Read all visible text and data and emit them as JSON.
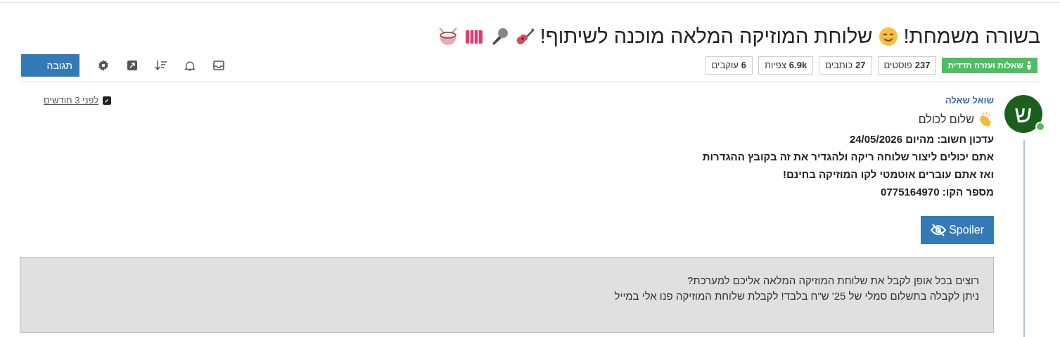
{
  "topic": {
    "title_start": "בשורה משמחת!",
    "title_end": "שלוחת המוזיקה המלאה מוכנה לשיתוף!",
    "category": "שאלות ועזרה הדדית",
    "stats": [
      {
        "value": "237",
        "label": "פוסטים"
      },
      {
        "value": "27",
        "label": "כותבים"
      },
      {
        "value": "6.9k",
        "label": "צפיות"
      },
      {
        "value": "6",
        "label": "עוקבים"
      }
    ]
  },
  "toolbar": {
    "reply_button": "תגובה"
  },
  "post": {
    "avatar_letter": "ש",
    "online": true,
    "author": "שואל שאלה",
    "time": "לפני 3 חודשים",
    "greeting": "שלום לכולם",
    "bold_lines": [
      "עדכון חשוב: מהיום 24/05/2026",
      "אתם יכולים ליצור שלוחה ריקה ולהגדיר את זה בקובץ ההגדרות",
      "ואז אתם עוברים אוטמטי לקו המוזיקה בחינם!",
      "מספר הקו: 0775164970"
    ],
    "spoiler_button": "Spoiler",
    "notice_lines": [
      "רוצים בכל אופן לקבל את שלוחת המוזיקה המלאה אליכם למערכת?",
      "ניתן לקבלה בתשלום סמלי של 25' ש\"ח בלבד! לקבלת שלוחת המוזיקה פנו אלי במייל"
    ]
  }
}
